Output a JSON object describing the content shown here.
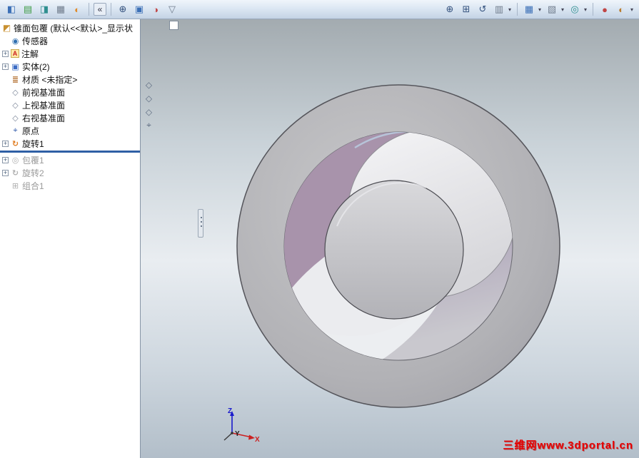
{
  "toolbar": {
    "collapse_glyph": "«",
    "dropdown_glyph": "▾",
    "left_icons": [
      {
        "name": "featuremanager-icon",
        "glyph": "◧"
      },
      {
        "name": "propertymanager-icon",
        "glyph": "▤"
      },
      {
        "name": "configurationmanager-icon",
        "glyph": "◨"
      },
      {
        "name": "dimxpert-icon",
        "glyph": "▦"
      },
      {
        "name": "display-manager-icon",
        "glyph": "◐"
      }
    ],
    "mid_icons": [
      {
        "name": "zoom-cursor-icon",
        "glyph": "⊕"
      },
      {
        "name": "view-cube-icon",
        "glyph": "▣"
      },
      {
        "name": "appearance-sphere-icon",
        "glyph": "◑"
      },
      {
        "name": "filter-icon",
        "glyph": "▽"
      }
    ],
    "right_icons": [
      {
        "name": "zoom-in-out-icon",
        "glyph": "⊕"
      },
      {
        "name": "zoom-area-icon",
        "glyph": "⊞"
      },
      {
        "name": "previous-view-icon",
        "glyph": "↺"
      },
      {
        "name": "section-view-icon",
        "glyph": "▥"
      },
      {
        "name": "view-orientation-icon",
        "glyph": "▦"
      },
      {
        "name": "display-style-icon",
        "glyph": "▧"
      },
      {
        "name": "hide-show-items-icon",
        "glyph": "◎"
      },
      {
        "name": "edit-appearance-icon",
        "glyph": "●"
      },
      {
        "name": "apply-scene-icon",
        "glyph": "◐"
      }
    ]
  },
  "panel": {
    "plus_glyph": "+",
    "rollback_color": "#2f5fa5",
    "tree_items": [
      {
        "label": "锥面包覆 (默认<<默认>_显示状",
        "glyph": "◩"
      },
      {
        "label": "传感器",
        "glyph": "◉"
      },
      {
        "label": "注解",
        "glyph": "A"
      },
      {
        "label": "实体(2)",
        "glyph": "▣"
      },
      {
        "label": "材质 <未指定>",
        "glyph": "≣"
      },
      {
        "label": "前视基准面",
        "glyph": "◇"
      },
      {
        "label": "上视基准面",
        "glyph": "◇"
      },
      {
        "label": "右视基准面",
        "glyph": "◇"
      },
      {
        "label": "原点",
        "glyph": "⌖"
      },
      {
        "label": "旋转1",
        "glyph": "↻"
      },
      {
        "label": "包覆1",
        "glyph": "◎"
      },
      {
        "label": "旋转2",
        "glyph": "↻"
      },
      {
        "label": "组合1",
        "glyph": "⊞"
      }
    ]
  },
  "flyout": {
    "plane_glyph": "◇",
    "origin_glyph": "⌖"
  },
  "viewport": {
    "watermark": "三维网www.3dportal.cn",
    "watermark_color": "#e60000",
    "triad": {
      "x": "X",
      "y": "Y",
      "z": "Z"
    }
  }
}
